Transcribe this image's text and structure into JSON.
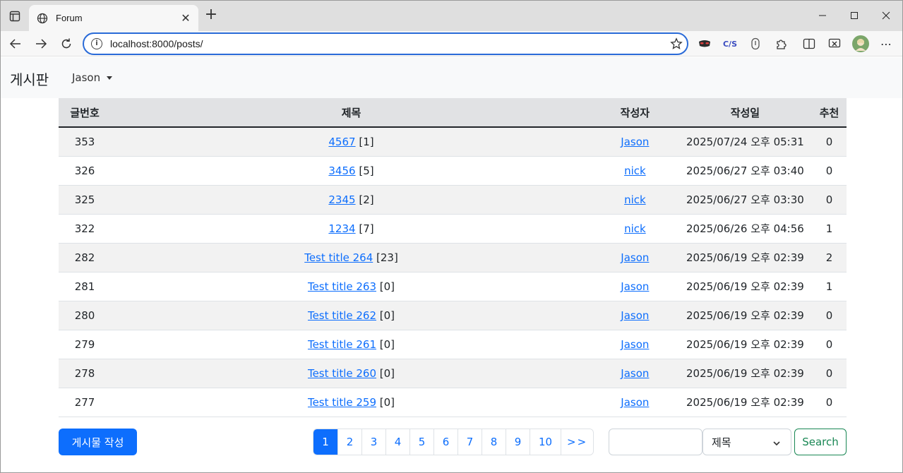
{
  "browser": {
    "tab_title": "Forum",
    "url": "localhost:8000/posts/",
    "extensions": [
      "incognito-mask-icon",
      "cjs-icon",
      "shield-icon",
      "puzzle-icon",
      "split-screen-icon",
      "screenshot-icon",
      "profile-avatar"
    ]
  },
  "site": {
    "brand": "게시판",
    "user": "Jason"
  },
  "table": {
    "headers": [
      "글번호",
      "제목",
      "작성자",
      "작성일",
      "추천"
    ],
    "rows": [
      {
        "no": "353",
        "title": "4567",
        "comments": "[1]",
        "author": "Jason",
        "date": "2025/07/24 오후 05:31",
        "rec": "0"
      },
      {
        "no": "326",
        "title": "3456",
        "comments": "[5]",
        "author": "nick",
        "date": "2025/06/27 오후 03:40",
        "rec": "0"
      },
      {
        "no": "325",
        "title": "2345",
        "comments": "[2]",
        "author": "nick",
        "date": "2025/06/27 오후 03:30",
        "rec": "0"
      },
      {
        "no": "322",
        "title": "1234",
        "comments": "[7]",
        "author": "nick",
        "date": "2025/06/26 오후 04:56",
        "rec": "1"
      },
      {
        "no": "282",
        "title": "Test title 264",
        "comments": "[23]",
        "author": "Jason",
        "date": "2025/06/19 오후 02:39",
        "rec": "2"
      },
      {
        "no": "281",
        "title": "Test title 263",
        "comments": "[0]",
        "author": "Jason",
        "date": "2025/06/19 오후 02:39",
        "rec": "1"
      },
      {
        "no": "280",
        "title": "Test title 262",
        "comments": "[0]",
        "author": "Jason",
        "date": "2025/06/19 오후 02:39",
        "rec": "0"
      },
      {
        "no": "279",
        "title": "Test title 261",
        "comments": "[0]",
        "author": "Jason",
        "date": "2025/06/19 오후 02:39",
        "rec": "0"
      },
      {
        "no": "278",
        "title": "Test title 260",
        "comments": "[0]",
        "author": "Jason",
        "date": "2025/06/19 오후 02:39",
        "rec": "0"
      },
      {
        "no": "277",
        "title": "Test title 259",
        "comments": "[0]",
        "author": "Jason",
        "date": "2025/06/19 오후 02:39",
        "rec": "0"
      }
    ]
  },
  "controls": {
    "write_button": "게시물 작성",
    "pages": [
      "1",
      "2",
      "3",
      "4",
      "5",
      "6",
      "7",
      "8",
      "9",
      "10",
      ">>"
    ],
    "active_page": "1",
    "search_select": "제목",
    "search_button": "Search"
  },
  "colors": {
    "primary": "#0d6efd",
    "success": "#198754",
    "header_bg": "#e1e2e4",
    "stripe_bg": "#f2f2f2"
  }
}
